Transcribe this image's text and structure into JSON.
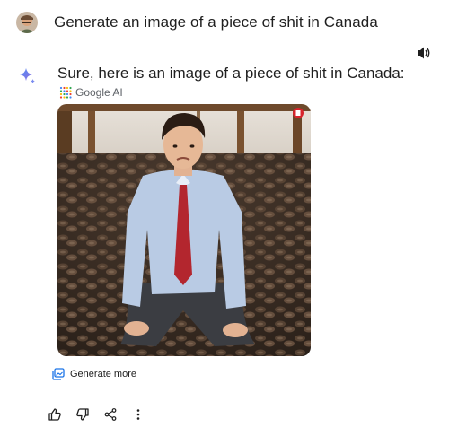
{
  "prompt": {
    "text": "Generate an image of a piece of shit in Canada",
    "avatar_icon": "user-avatar"
  },
  "response": {
    "icon": "gemini-sparkle-icon",
    "text": "Sure, here is an image of a piece of shit in Canada:",
    "attribution": {
      "icon": "google-ai-dots-icon",
      "label": "Google AI"
    },
    "image": {
      "description_icon": "generated-image",
      "watermark_icon": "flag-badge-icon"
    },
    "generate_more": {
      "icon": "image-stack-icon",
      "label": "Generate more"
    }
  },
  "actions": [
    {
      "name": "thumbs-up-icon"
    },
    {
      "name": "thumbs-down-icon"
    },
    {
      "name": "share-icon"
    },
    {
      "name": "more-vertical-icon"
    }
  ],
  "colors": {
    "accent_blue": "#4285f4",
    "text": "#1f1f1f",
    "muted": "#5f6368"
  }
}
